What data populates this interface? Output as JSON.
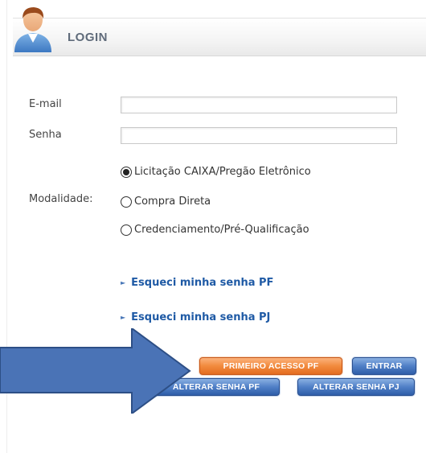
{
  "header": {
    "title": "LOGIN",
    "icon": "user-avatar-icon"
  },
  "form": {
    "email_label": "E-mail",
    "email_value": "",
    "senha_label": "Senha",
    "senha_value": "",
    "modalidade_label": "Modalidade:",
    "modalidade_options": [
      {
        "label": "Licitação CAIXA/Pregão Eletrônico",
        "checked": true
      },
      {
        "label": "Compra Direta",
        "checked": false
      },
      {
        "label": "Credenciamento/Pré-Qualificação",
        "checked": false
      }
    ]
  },
  "links": {
    "forgot_pf": "Esqueci minha senha PF",
    "forgot_pj": "Esqueci minha senha PJ"
  },
  "buttons": {
    "primeiro_acesso": "PRIMEIRO ACESSO PF",
    "entrar": "ENTRAR",
    "alterar_pf": "ALTERAR SENHA PF",
    "alterar_pj": "ALTERAR SENHA PJ"
  },
  "colors": {
    "arrow_fill": "#4a73b6",
    "orange_button": "#f28a3d",
    "blue_button": "#4f7fc6",
    "link": "#1f5aa5"
  },
  "annotation": {
    "icon": "right-arrow-icon"
  }
}
